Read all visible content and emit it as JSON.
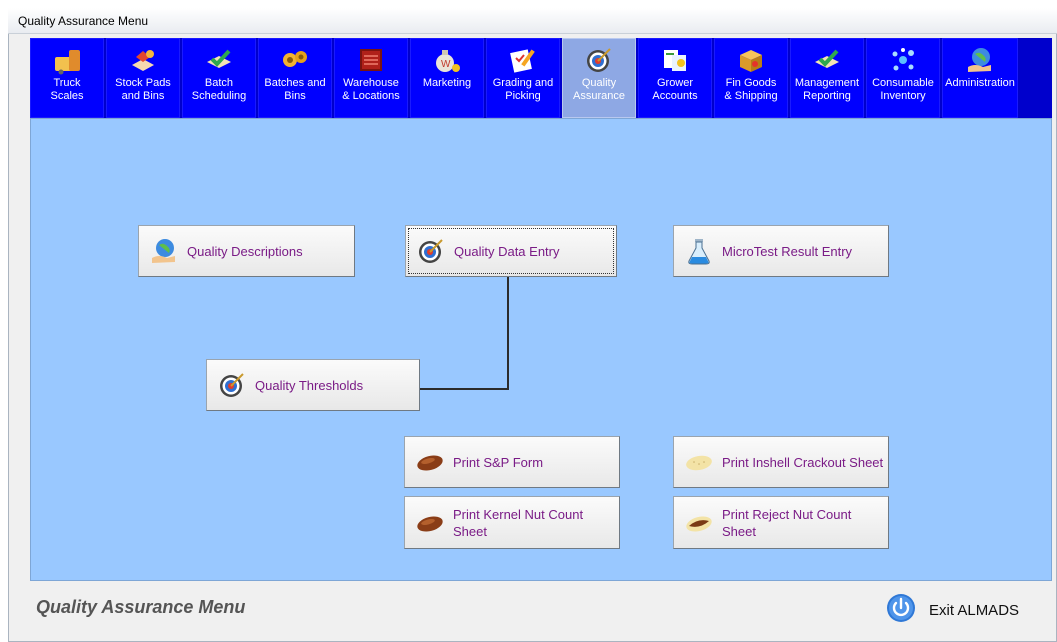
{
  "window": {
    "title": "Quality Assurance Menu"
  },
  "nav": {
    "tabs": [
      {
        "label": "Truck\nScales",
        "icon": "truck-scales-icon"
      },
      {
        "label": "Stock Pads\nand Bins",
        "icon": "stock-pads-icon"
      },
      {
        "label": "Batch\nScheduling",
        "icon": "batch-scheduling-icon"
      },
      {
        "label": "Batches and\nBins",
        "icon": "batches-bins-icon"
      },
      {
        "label": "Warehouse\n& Locations",
        "icon": "warehouse-icon"
      },
      {
        "label": "Marketing",
        "icon": "money-bag-icon"
      },
      {
        "label": "Grading and\nPicking",
        "icon": "grading-icon"
      },
      {
        "label": "Quality\nAssurance",
        "icon": "target-icon",
        "active": true
      },
      {
        "label": "Grower\nAccounts",
        "icon": "grower-accounts-icon"
      },
      {
        "label": "Fin Goods\n& Shipping",
        "icon": "shipping-box-icon"
      },
      {
        "label": "Management\nReporting",
        "icon": "reporting-icon"
      },
      {
        "label": "Consumable\nInventory",
        "icon": "molecule-icon"
      },
      {
        "label": "Administration",
        "icon": "globe-hand-icon"
      }
    ]
  },
  "buttons": {
    "quality_descriptions": {
      "label": "Quality Descriptions",
      "icon": "globe-hand-icon"
    },
    "quality_data_entry": {
      "label": "Quality Data Entry",
      "icon": "target-icon"
    },
    "microtest_result_entry": {
      "label": "MicroTest Result Entry",
      "icon": "flask-icon"
    },
    "quality_thresholds": {
      "label": "Quality Thresholds",
      "icon": "target-icon"
    },
    "print_sp_form": {
      "label": "Print S&P Form",
      "icon": "almond-icon"
    },
    "print_inshell_crackout": {
      "label": "Print Inshell Crackout Sheet",
      "icon": "inshell-almond-icon"
    },
    "print_kernel_nut_count": {
      "label": "Print Kernel Nut Count\nSheet",
      "icon": "almond-icon"
    },
    "print_reject_nut_count": {
      "label": "Print Reject Nut Count\nSheet",
      "icon": "reject-nut-icon"
    }
  },
  "footer": {
    "title": "Quality Assurance Menu",
    "exit_label": "Exit ALMADS",
    "exit_icon": "power-icon"
  },
  "colors": {
    "nav_background": "#0000ff",
    "nav_active": "#8ea8e4",
    "content_background": "#99c8ff",
    "button_text": "#7a1b86"
  }
}
